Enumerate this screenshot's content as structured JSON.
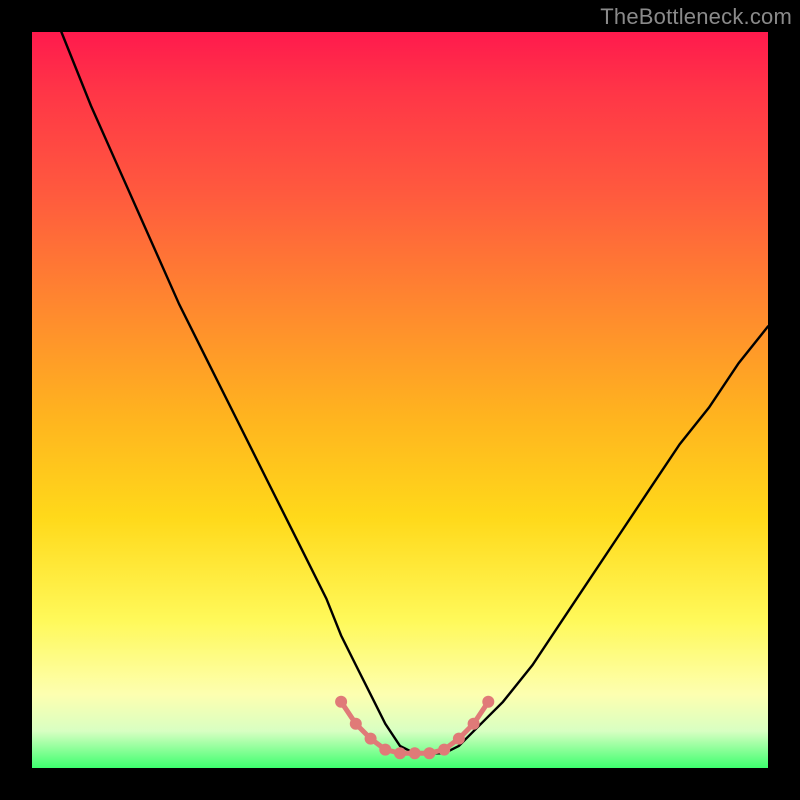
{
  "watermark": "TheBottleneck.com",
  "chart_data": {
    "type": "line",
    "title": "",
    "xlabel": "",
    "ylabel": "",
    "xlim": [
      0,
      100
    ],
    "ylim": [
      0,
      100
    ],
    "grid": false,
    "legend": null,
    "series": [
      {
        "name": "bottleneck-curve",
        "x": [
          4,
          8,
          12,
          16,
          20,
          24,
          28,
          32,
          36,
          40,
          42,
          44,
          46,
          48,
          50,
          52,
          54,
          56,
          58,
          60,
          64,
          68,
          72,
          76,
          80,
          84,
          88,
          92,
          96,
          100
        ],
        "y": [
          100,
          90,
          81,
          72,
          63,
          55,
          47,
          39,
          31,
          23,
          18,
          14,
          10,
          6,
          3,
          2,
          2,
          2,
          3,
          5,
          9,
          14,
          20,
          26,
          32,
          38,
          44,
          49,
          55,
          60
        ]
      }
    ],
    "markers": {
      "name": "valley-markers",
      "color": "#e07a78",
      "points": [
        {
          "x": 42,
          "y": 9
        },
        {
          "x": 44,
          "y": 6
        },
        {
          "x": 46,
          "y": 4
        },
        {
          "x": 48,
          "y": 2.5
        },
        {
          "x": 50,
          "y": 2
        },
        {
          "x": 52,
          "y": 2
        },
        {
          "x": 54,
          "y": 2
        },
        {
          "x": 56,
          "y": 2.5
        },
        {
          "x": 58,
          "y": 4
        },
        {
          "x": 60,
          "y": 6
        },
        {
          "x": 62,
          "y": 9
        }
      ]
    }
  }
}
